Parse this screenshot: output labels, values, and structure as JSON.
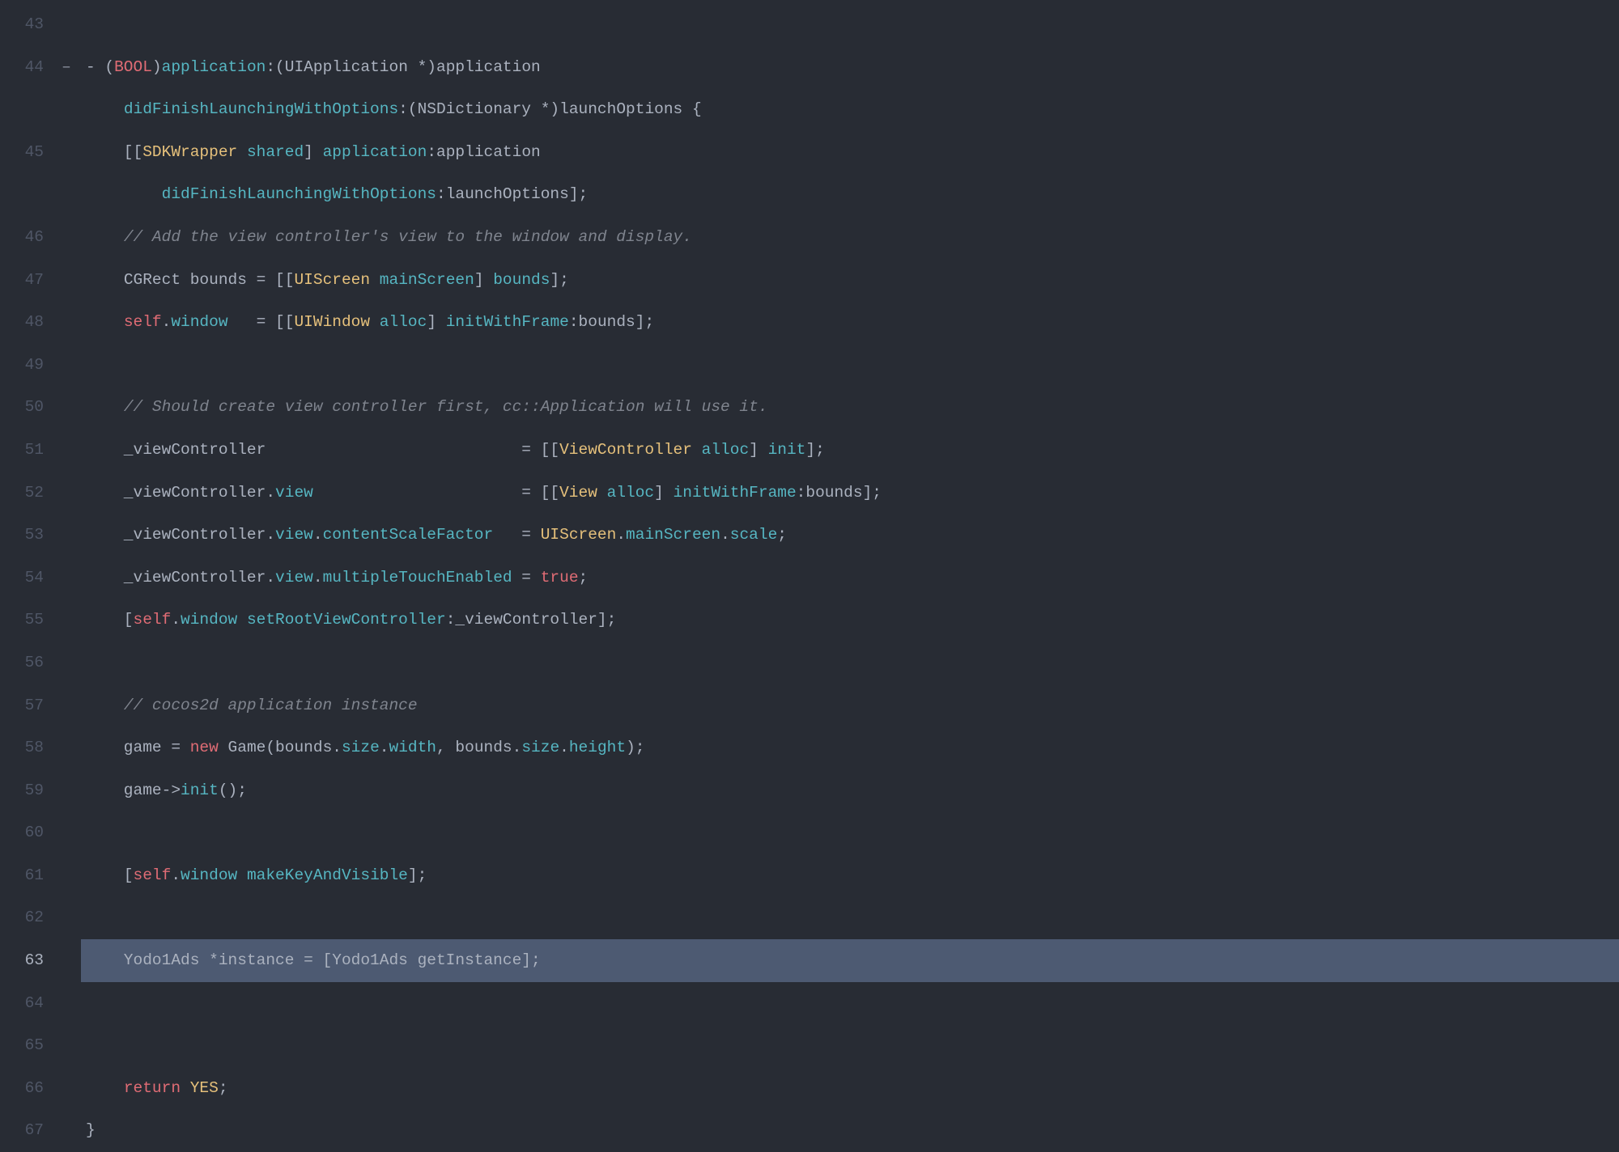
{
  "first_line_number": 43,
  "highlighted_line_number": 63,
  "markers": {
    "44": "–"
  },
  "lines": [
    {
      "n": 43,
      "tokens": []
    },
    {
      "n": 44,
      "tokens": [
        {
          "t": "- (",
          "c": "c-default"
        },
        {
          "t": "BOOL",
          "c": "c-redkw"
        },
        {
          "t": ")",
          "c": "c-default"
        },
        {
          "t": "application",
          "c": "c-method"
        },
        {
          "t": ":(",
          "c": "c-default"
        },
        {
          "t": "UIApplication",
          "c": "c-default"
        },
        {
          "t": " *)",
          "c": "c-default"
        },
        {
          "t": "application",
          "c": "c-default"
        }
      ]
    },
    {
      "n": "44b",
      "tokens": [
        {
          "t": "    ",
          "c": "c-default"
        },
        {
          "t": "didFinishLaunchingWithOptions",
          "c": "c-method"
        },
        {
          "t": ":(",
          "c": "c-default"
        },
        {
          "t": "NSDictionary",
          "c": "c-default"
        },
        {
          "t": " *)",
          "c": "c-default"
        },
        {
          "t": "launchOptions",
          "c": "c-default"
        },
        {
          "t": " {",
          "c": "c-default"
        }
      ]
    },
    {
      "n": 45,
      "tokens": [
        {
          "t": "    [[",
          "c": "c-default"
        },
        {
          "t": "SDKWrapper",
          "c": "c-type"
        },
        {
          "t": " ",
          "c": "c-default"
        },
        {
          "t": "shared",
          "c": "c-method"
        },
        {
          "t": "] ",
          "c": "c-default"
        },
        {
          "t": "application",
          "c": "c-method"
        },
        {
          "t": ":",
          "c": "c-default"
        },
        {
          "t": "application",
          "c": "c-default"
        }
      ]
    },
    {
      "n": "45b",
      "tokens": [
        {
          "t": "        ",
          "c": "c-default"
        },
        {
          "t": "didFinishLaunchingWithOptions",
          "c": "c-method"
        },
        {
          "t": ":",
          "c": "c-default"
        },
        {
          "t": "launchOptions",
          "c": "c-default"
        },
        {
          "t": "];",
          "c": "c-default"
        }
      ]
    },
    {
      "n": 46,
      "tokens": [
        {
          "t": "    ",
          "c": "c-default"
        },
        {
          "t": "// Add the view controller's view to the window and display.",
          "c": "c-comment"
        }
      ]
    },
    {
      "n": 47,
      "tokens": [
        {
          "t": "    ",
          "c": "c-default"
        },
        {
          "t": "CGRect",
          "c": "c-default"
        },
        {
          "t": " bounds = [[",
          "c": "c-default"
        },
        {
          "t": "UIScreen",
          "c": "c-type"
        },
        {
          "t": " ",
          "c": "c-default"
        },
        {
          "t": "mainScreen",
          "c": "c-method"
        },
        {
          "t": "] ",
          "c": "c-default"
        },
        {
          "t": "bounds",
          "c": "c-method"
        },
        {
          "t": "];",
          "c": "c-default"
        }
      ]
    },
    {
      "n": 48,
      "tokens": [
        {
          "t": "    ",
          "c": "c-default"
        },
        {
          "t": "self",
          "c": "c-self"
        },
        {
          "t": ".",
          "c": "c-default"
        },
        {
          "t": "window",
          "c": "c-method"
        },
        {
          "t": "   = [[",
          "c": "c-default"
        },
        {
          "t": "UIWindow",
          "c": "c-type"
        },
        {
          "t": " ",
          "c": "c-default"
        },
        {
          "t": "alloc",
          "c": "c-method"
        },
        {
          "t": "] ",
          "c": "c-default"
        },
        {
          "t": "initWithFrame",
          "c": "c-method"
        },
        {
          "t": ":bounds];",
          "c": "c-default"
        }
      ]
    },
    {
      "n": 49,
      "tokens": []
    },
    {
      "n": 50,
      "tokens": [
        {
          "t": "    ",
          "c": "c-default"
        },
        {
          "t": "// Should create view controller first, cc::Application will use it.",
          "c": "c-comment"
        }
      ]
    },
    {
      "n": 51,
      "tokens": [
        {
          "t": "    _viewController                           = [[",
          "c": "c-default"
        },
        {
          "t": "ViewController",
          "c": "c-type"
        },
        {
          "t": " ",
          "c": "c-default"
        },
        {
          "t": "alloc",
          "c": "c-method"
        },
        {
          "t": "] ",
          "c": "c-default"
        },
        {
          "t": "init",
          "c": "c-method"
        },
        {
          "t": "];",
          "c": "c-default"
        }
      ]
    },
    {
      "n": 52,
      "tokens": [
        {
          "t": "    _viewController.",
          "c": "c-default"
        },
        {
          "t": "view",
          "c": "c-method"
        },
        {
          "t": "                      = [[",
          "c": "c-default"
        },
        {
          "t": "View",
          "c": "c-type"
        },
        {
          "t": " ",
          "c": "c-default"
        },
        {
          "t": "alloc",
          "c": "c-method"
        },
        {
          "t": "] ",
          "c": "c-default"
        },
        {
          "t": "initWithFrame",
          "c": "c-method"
        },
        {
          "t": ":bounds];",
          "c": "c-default"
        }
      ]
    },
    {
      "n": 53,
      "tokens": [
        {
          "t": "    _viewController.",
          "c": "c-default"
        },
        {
          "t": "view",
          "c": "c-method"
        },
        {
          "t": ".",
          "c": "c-default"
        },
        {
          "t": "contentScaleFactor",
          "c": "c-method"
        },
        {
          "t": "   = ",
          "c": "c-default"
        },
        {
          "t": "UIScreen",
          "c": "c-type"
        },
        {
          "t": ".",
          "c": "c-default"
        },
        {
          "t": "mainScreen",
          "c": "c-method"
        },
        {
          "t": ".",
          "c": "c-default"
        },
        {
          "t": "scale",
          "c": "c-method"
        },
        {
          "t": ";",
          "c": "c-default"
        }
      ]
    },
    {
      "n": 54,
      "tokens": [
        {
          "t": "    _viewController.",
          "c": "c-default"
        },
        {
          "t": "view",
          "c": "c-method"
        },
        {
          "t": ".",
          "c": "c-default"
        },
        {
          "t": "multipleTouchEnabled",
          "c": "c-method"
        },
        {
          "t": " = ",
          "c": "c-default"
        },
        {
          "t": "true",
          "c": "c-truekw"
        },
        {
          "t": ";",
          "c": "c-default"
        }
      ]
    },
    {
      "n": 55,
      "tokens": [
        {
          "t": "    [",
          "c": "c-default"
        },
        {
          "t": "self",
          "c": "c-self"
        },
        {
          "t": ".",
          "c": "c-default"
        },
        {
          "t": "window",
          "c": "c-method"
        },
        {
          "t": " ",
          "c": "c-default"
        },
        {
          "t": "setRootViewController",
          "c": "c-method"
        },
        {
          "t": ":_viewController];",
          "c": "c-default"
        }
      ]
    },
    {
      "n": 56,
      "tokens": []
    },
    {
      "n": 57,
      "tokens": [
        {
          "t": "    ",
          "c": "c-default"
        },
        {
          "t": "// cocos2d application instance",
          "c": "c-comment"
        }
      ]
    },
    {
      "n": 58,
      "tokens": [
        {
          "t": "    game = ",
          "c": "c-default"
        },
        {
          "t": "new",
          "c": "c-redkw"
        },
        {
          "t": " ",
          "c": "c-default"
        },
        {
          "t": "Game",
          "c": "c-default"
        },
        {
          "t": "(bounds.",
          "c": "c-default"
        },
        {
          "t": "size",
          "c": "c-method"
        },
        {
          "t": ".",
          "c": "c-default"
        },
        {
          "t": "width",
          "c": "c-method"
        },
        {
          "t": ", bounds.",
          "c": "c-default"
        },
        {
          "t": "size",
          "c": "c-method"
        },
        {
          "t": ".",
          "c": "c-default"
        },
        {
          "t": "height",
          "c": "c-method"
        },
        {
          "t": ");",
          "c": "c-default"
        }
      ]
    },
    {
      "n": 59,
      "tokens": [
        {
          "t": "    game->",
          "c": "c-default"
        },
        {
          "t": "init",
          "c": "c-method"
        },
        {
          "t": "();",
          "c": "c-default"
        }
      ]
    },
    {
      "n": 60,
      "tokens": []
    },
    {
      "n": 61,
      "tokens": [
        {
          "t": "    [",
          "c": "c-default"
        },
        {
          "t": "self",
          "c": "c-self"
        },
        {
          "t": ".",
          "c": "c-default"
        },
        {
          "t": "window",
          "c": "c-method"
        },
        {
          "t": " ",
          "c": "c-default"
        },
        {
          "t": "makeKeyAndVisible",
          "c": "c-method"
        },
        {
          "t": "];",
          "c": "c-default"
        }
      ]
    },
    {
      "n": 62,
      "tokens": []
    },
    {
      "n": 63,
      "highlighted": true,
      "tokens": [
        {
          "t": "    Yodo1Ads *instance = [Yodo1Ads getInstance];",
          "c": "c-default"
        }
      ]
    },
    {
      "n": 64,
      "tokens": []
    },
    {
      "n": 65,
      "tokens": []
    },
    {
      "n": 66,
      "tokens": [
        {
          "t": "    ",
          "c": "c-default"
        },
        {
          "t": "return",
          "c": "c-redkw"
        },
        {
          "t": " ",
          "c": "c-default"
        },
        {
          "t": "YES",
          "c": "c-type"
        },
        {
          "t": ";",
          "c": "c-default"
        }
      ]
    },
    {
      "n": 67,
      "tokens": [
        {
          "t": "}",
          "c": "c-default"
        }
      ]
    }
  ]
}
